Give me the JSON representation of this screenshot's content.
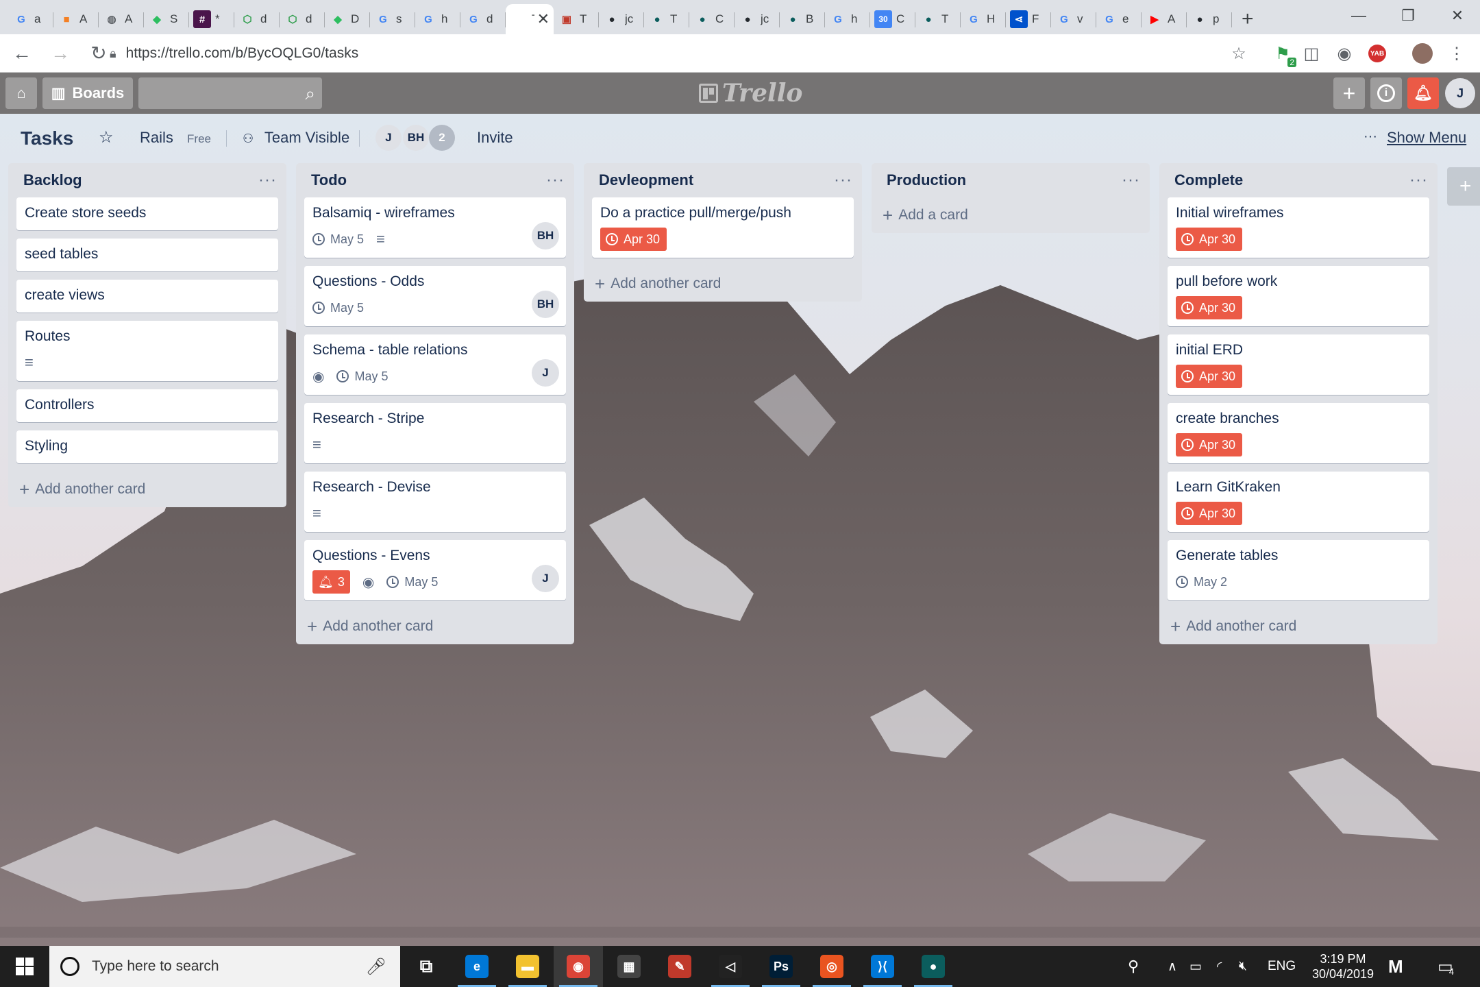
{
  "browser": {
    "tabs": [
      {
        "icon": "google-icon",
        "glyph": "G",
        "color": "#4285f4",
        "title": "a"
      },
      {
        "icon": "cube-icon",
        "glyph": "■",
        "color": "#f48024",
        "title": "A"
      },
      {
        "icon": "globe-icon",
        "glyph": "◍",
        "color": "#5f6368",
        "title": "A"
      },
      {
        "icon": "evernote-icon",
        "glyph": "◆",
        "color": "#2dbe60",
        "title": "S"
      },
      {
        "icon": "slack-icon",
        "glyph": "#",
        "color": "#4a154b",
        "title": "*"
      },
      {
        "icon": "cube-outline-icon",
        "glyph": "⬡",
        "color": "#2e9d4b",
        "title": "d"
      },
      {
        "icon": "cube-outline-icon",
        "glyph": "⬡",
        "color": "#2e9d4b",
        "title": "d"
      },
      {
        "icon": "evernote-icon",
        "glyph": "◆",
        "color": "#2dbe60",
        "title": "D"
      },
      {
        "icon": "google-icon",
        "glyph": "G",
        "color": "#4285f4",
        "title": "s"
      },
      {
        "icon": "google-icon",
        "glyph": "G",
        "color": "#4285f4",
        "title": "h"
      },
      {
        "icon": "google-icon",
        "glyph": "G",
        "color": "#4285f4",
        "title": "d"
      },
      {
        "icon": "trello-icon",
        "glyph": "",
        "color": "#ffffff",
        "title": "Ta",
        "active": true
      },
      {
        "icon": "app-icon",
        "glyph": "▣",
        "color": "#c0392b",
        "title": "T"
      },
      {
        "icon": "github-icon",
        "glyph": "●",
        "color": "#24292e",
        "title": "jc"
      },
      {
        "icon": "gitkraken-icon",
        "glyph": "●",
        "color": "#0b5d5d",
        "title": "T"
      },
      {
        "icon": "gitkraken-icon",
        "glyph": "●",
        "color": "#0b5d5d",
        "title": "C"
      },
      {
        "icon": "github-icon",
        "glyph": "●",
        "color": "#24292e",
        "title": "jc"
      },
      {
        "icon": "gitkraken-icon",
        "glyph": "●",
        "color": "#0b5d5d",
        "title": "B"
      },
      {
        "icon": "google-icon",
        "glyph": "G",
        "color": "#4285f4",
        "title": "h"
      },
      {
        "icon": "calendar-icon",
        "glyph": "30",
        "color": "#4285f4",
        "title": "C"
      },
      {
        "icon": "gitkraken-icon",
        "glyph": "●",
        "color": "#0b5d5d",
        "title": "T"
      },
      {
        "icon": "google-icon",
        "glyph": "G",
        "color": "#4285f4",
        "title": "H"
      },
      {
        "icon": "sourcetree-icon",
        "glyph": "⋖",
        "color": "#0052cc",
        "title": "F"
      },
      {
        "icon": "google-icon",
        "glyph": "G",
        "color": "#4285f4",
        "title": "v"
      },
      {
        "icon": "google-icon",
        "glyph": "G",
        "color": "#4285f4",
        "title": "e"
      },
      {
        "icon": "youtube-icon",
        "glyph": "▶",
        "color": "#ff0000",
        "title": "A"
      },
      {
        "icon": "github-icon",
        "glyph": "●",
        "color": "#24292e",
        "title": "p"
      }
    ],
    "url": "https://trello.com/b/BycOQLG0/tasks",
    "ext_badge": "2",
    "ext_yab": "YAB"
  },
  "trello": {
    "boards_label": "Boards",
    "logo": "Trello",
    "user_initial": "J"
  },
  "board": {
    "title": "Tasks",
    "team": "Rails",
    "team_plan": "Free",
    "visibility": "Team Visible",
    "members": [
      "J",
      "BH"
    ],
    "member_count": "2",
    "invite": "Invite",
    "menu_dots": "···",
    "show_menu": "Show Menu"
  },
  "lists": [
    {
      "title": "Backlog",
      "add_label": "Add another card",
      "cards": [
        {
          "title": "Create store seeds"
        },
        {
          "title": "seed tables"
        },
        {
          "title": "create views"
        },
        {
          "title": "Routes",
          "desc": true
        },
        {
          "title": "Controllers"
        },
        {
          "title": "Styling"
        }
      ]
    },
    {
      "title": "Todo",
      "add_label": "Add another card",
      "cards": [
        {
          "title": "Balsamiq - wireframes",
          "due": "May 5",
          "desc": true,
          "member": "BH"
        },
        {
          "title": "Questions - Odds",
          "due": "May 5",
          "member": "BH"
        },
        {
          "title": "Schema - table relations",
          "watch": true,
          "due": "May 5",
          "member": "J"
        },
        {
          "title": "Research - Stripe",
          "desc": true
        },
        {
          "title": "Research - Devise",
          "desc": true
        },
        {
          "title": "Questions - Evens",
          "notif": "3",
          "watch": true,
          "due": "May 5",
          "member": "J"
        }
      ]
    },
    {
      "title": "Devleopment",
      "add_label": "Add another card",
      "cards": [
        {
          "title": "Do a practice pull/merge/push",
          "due_red": "Apr 30"
        }
      ]
    },
    {
      "title": "Production",
      "add_label": "Add a card",
      "cards": []
    },
    {
      "title": "Complete",
      "add_label": "Add another card",
      "cards": [
        {
          "title": "Initial wireframes",
          "due_red": "Apr 30"
        },
        {
          "title": "pull before work",
          "due_red": "Apr 30"
        },
        {
          "title": "initial ERD",
          "due_red": "Apr 30"
        },
        {
          "title": "create branches",
          "due_red": "Apr 30"
        },
        {
          "title": "Learn GitKraken",
          "due_red": "Apr 30"
        },
        {
          "title": "Generate tables",
          "due": "May 2"
        }
      ]
    }
  ],
  "taskbar": {
    "search_placeholder": "Type here to search",
    "lang": "ENG",
    "time": "3:19 PM",
    "date": "30/04/2019",
    "notif_count": "4",
    "apps": [
      {
        "icon": "task-view-icon",
        "glyph": "⧉",
        "color": "#1f1f1f"
      },
      {
        "icon": "edge-icon",
        "glyph": "e",
        "color": "#0078d7"
      },
      {
        "icon": "file-explorer-icon",
        "glyph": "▬",
        "color": "#f2c230"
      },
      {
        "icon": "chrome-icon",
        "glyph": "◉",
        "color": "#db4437",
        "active": true
      },
      {
        "icon": "store-icon",
        "glyph": "▦",
        "color": "#444444"
      },
      {
        "icon": "paint-icon",
        "glyph": "✎",
        "color": "#c0392b"
      },
      {
        "icon": "unity-icon",
        "glyph": "◁",
        "color": "#222222"
      },
      {
        "icon": "photoshop-icon",
        "glyph": "Ps",
        "color": "#001e36"
      },
      {
        "icon": "ubuntu-icon",
        "glyph": "◎",
        "color": "#e95420"
      },
      {
        "icon": "vscode-icon",
        "glyph": "⟩⟨",
        "color": "#0078d7"
      },
      {
        "icon": "gitkraken-app-icon",
        "glyph": "●",
        "color": "#0b5d5d"
      }
    ]
  }
}
